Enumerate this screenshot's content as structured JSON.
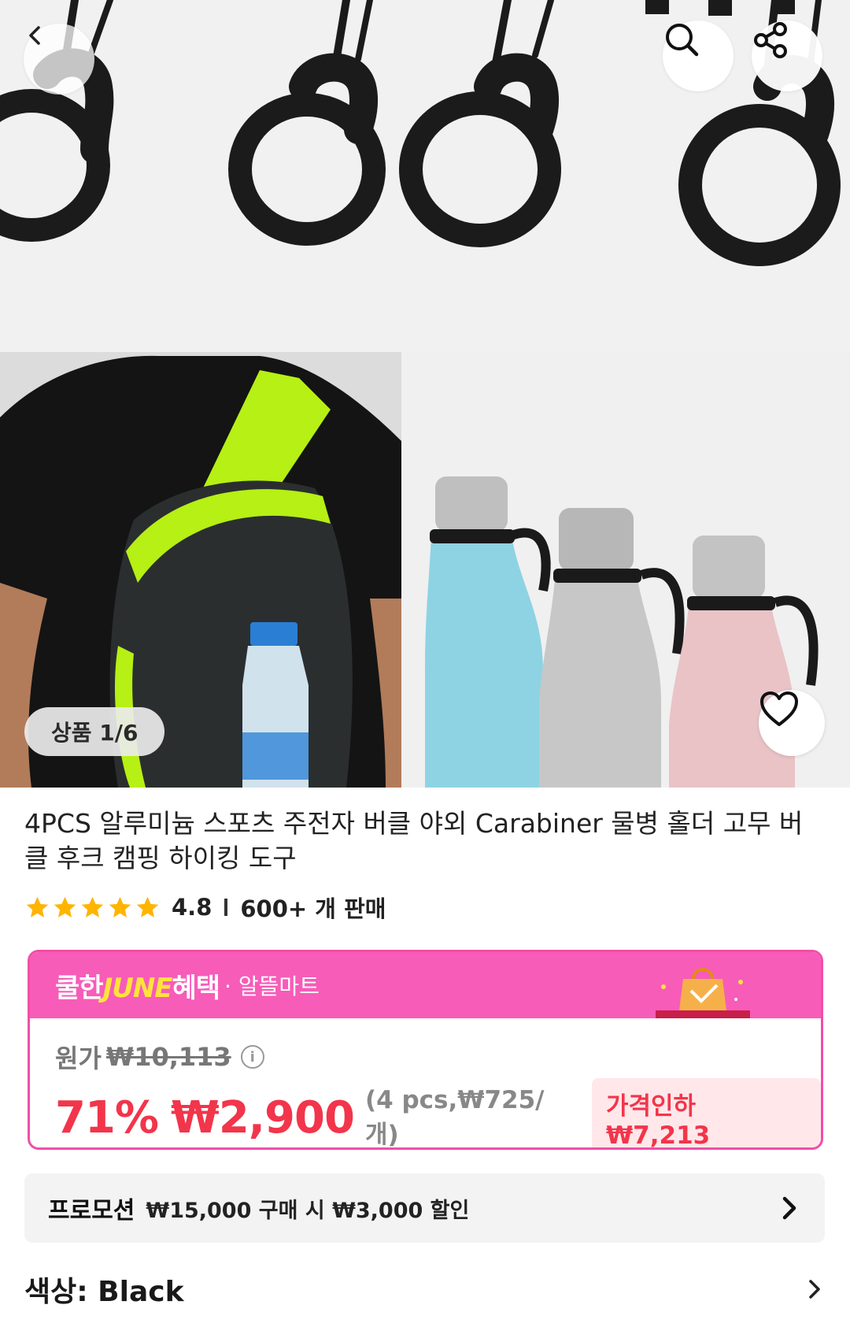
{
  "header": {
    "back_icon": "chevron-left-icon",
    "search_icon": "search-icon",
    "share_icon": "share-icon"
  },
  "gallery": {
    "counter": "상품 1/6",
    "wishlist_icon": "heart-icon"
  },
  "product": {
    "title": "4PCS 알루미늄 스포츠 주전자 버클 야외 Carabiner 물병 홀더 고무 버클 후크 캠핑 하이킹 도구",
    "rating": "4.8",
    "stars": 5,
    "sold": "600+ 개 판매"
  },
  "price_box": {
    "promo_brand_a": "쿨한",
    "promo_brand_b": "JUNE",
    "promo_brand_c": "혜택",
    "promo_sub": "· 알뜰마트",
    "original_label": "원가",
    "original_price": "₩10,113",
    "discount": "71%",
    "sale_price": "₩2,900",
    "unit_info": "(4 pcs,₩725/개)",
    "price_drop": "가격인하 ₩7,213"
  },
  "promotion": {
    "label": "프로모션",
    "text": "₩15,000 구매 시 ₩3,000 할인"
  },
  "option": {
    "color_label": "색상: Black"
  },
  "colors": {
    "accent_pink": "#f75cb8",
    "price_red": "#f2354b",
    "june_yellow": "#ffe23c"
  }
}
